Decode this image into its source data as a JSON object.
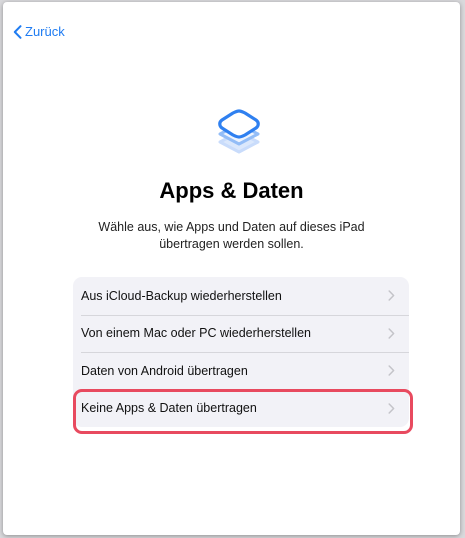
{
  "nav": {
    "back_label": "Zurück"
  },
  "header": {
    "title": "Apps & Daten",
    "subtitle": "Wähle aus, wie Apps und Daten auf dieses iPad übertragen werden sollen."
  },
  "options": [
    {
      "label": "Aus iCloud-Backup wiederherstellen"
    },
    {
      "label": "Von einem Mac oder PC wiederherstellen"
    },
    {
      "label": "Daten von Android übertragen"
    },
    {
      "label": "Keine Apps & Daten übertragen"
    }
  ],
  "colors": {
    "accent": "#1f7cf2",
    "highlight": "#e84a5f",
    "list_background": "#f2f2f7"
  },
  "icons": {
    "back": "chevron-left-icon",
    "hero": "apps-data-layers-icon",
    "row": "chevron-right-icon"
  }
}
